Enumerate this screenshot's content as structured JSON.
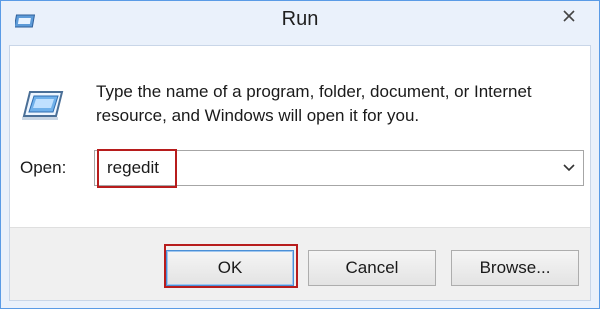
{
  "window": {
    "title": "Run",
    "icon": "run-dialog-icon",
    "close_icon": "close-icon"
  },
  "dialog": {
    "description": "Type the name of a program, folder, document, or Internet resource, and Windows will open it for you.",
    "open_label": "Open:",
    "open_value": "regedit",
    "dropdown_icon": "chevron-down-icon"
  },
  "buttons": {
    "ok": "OK",
    "cancel": "Cancel",
    "browse": "Browse..."
  },
  "colors": {
    "highlight": "#b71c1c",
    "frame": "#5a9be6"
  }
}
